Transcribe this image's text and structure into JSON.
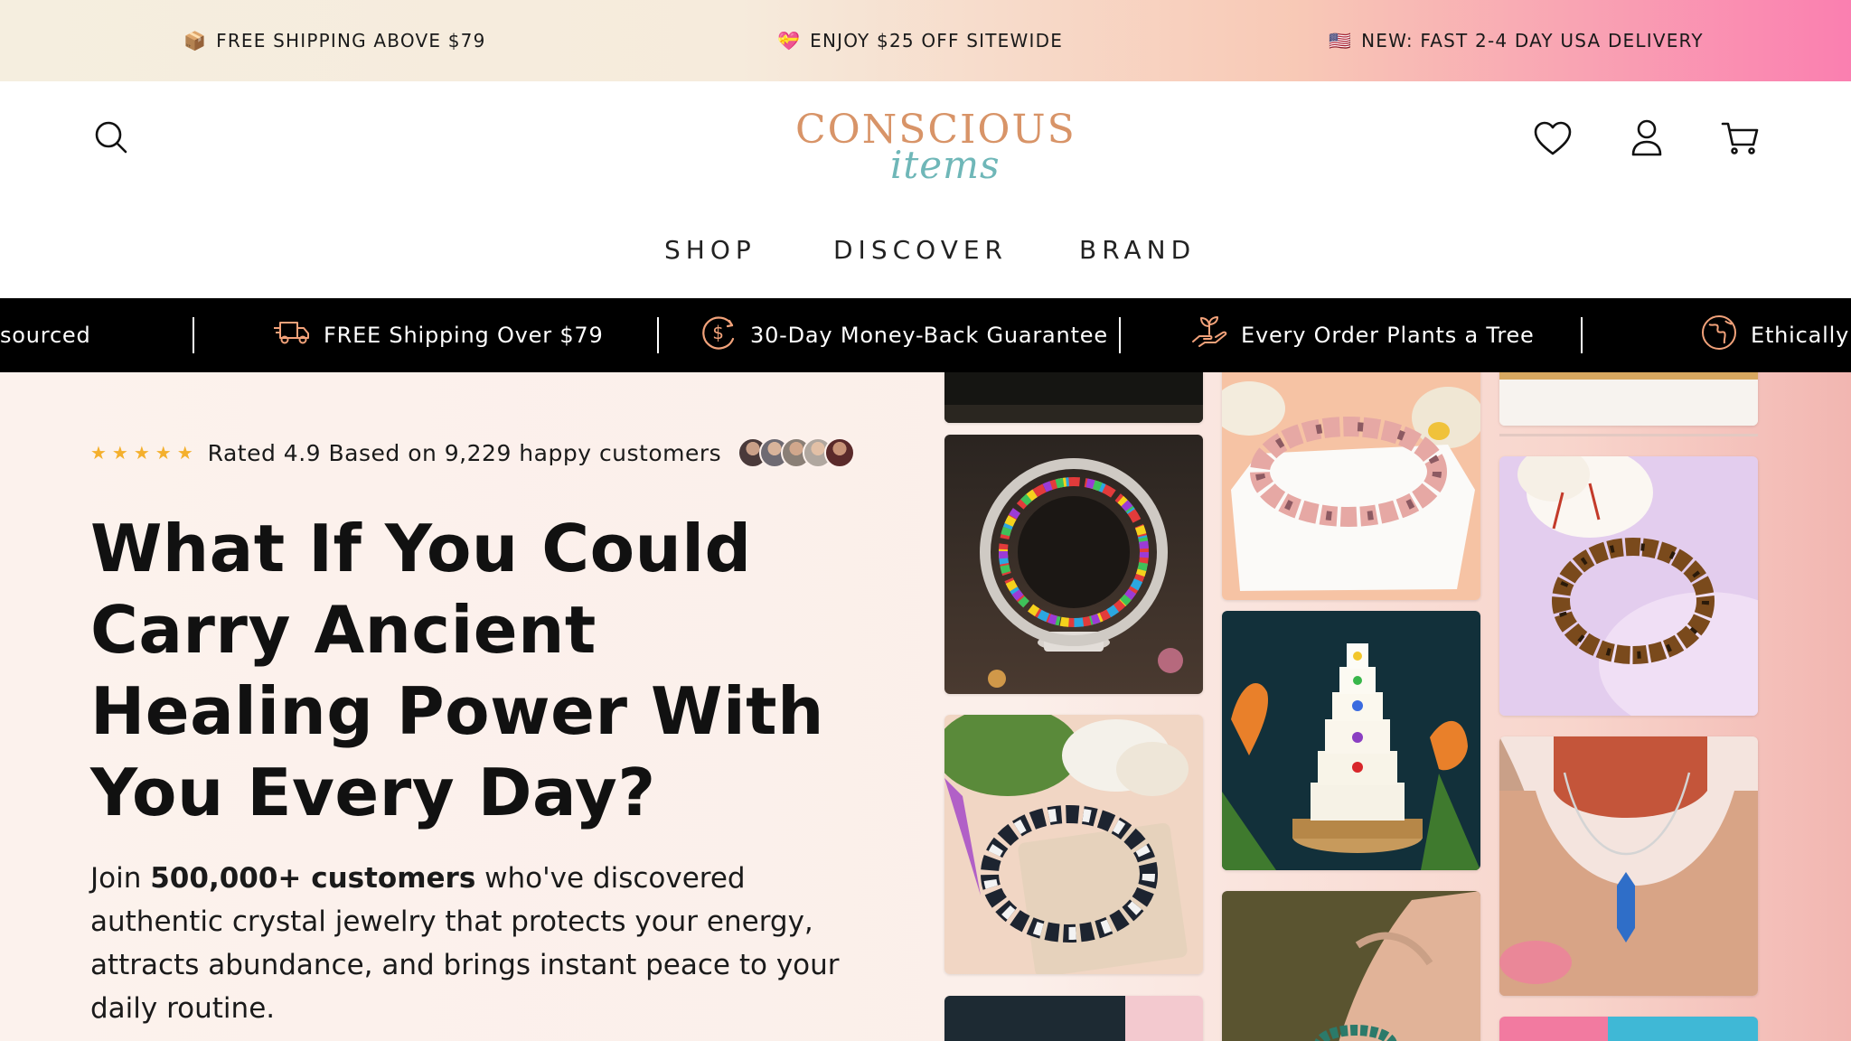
{
  "announcement": {
    "items": [
      {
        "emoji": "📦",
        "text": "FREE SHIPPING ABOVE $79"
      },
      {
        "emoji": "💝",
        "text": "ENJOY $25 OFF SITEWIDE"
      },
      {
        "emoji": "🇺🇸",
        "text": "NEW: FAST 2-4 DAY USA DELIVERY"
      }
    ]
  },
  "header": {
    "logo_main": "CONSCIOUS",
    "logo_sub": "items",
    "icons": [
      "search-icon",
      "heart-icon",
      "user-icon",
      "cart-icon"
    ],
    "nav": [
      "SHOP",
      "DISCOVER",
      "BRAND"
    ]
  },
  "trust": {
    "items": [
      {
        "icon": "globe-icon",
        "text": "sourced"
      },
      {
        "icon": "truck-icon",
        "text": "FREE Shipping Over $79"
      },
      {
        "icon": "dollar-circle-icon",
        "text": "30-Day Money-Back Guarantee"
      },
      {
        "icon": "plant-hand-icon",
        "text": "Every Order Plants a Tree"
      },
      {
        "icon": "globe-icon",
        "text": "Ethically s"
      }
    ]
  },
  "hero": {
    "stars": "★★★★★",
    "rating_text": "Rated 4.9 Based on 9,229 happy customers",
    "headline": "What If You Could Carry Ancient Healing Power With You Every Day?",
    "sub_pre": "Join ",
    "sub_bold": "500,000+ customers",
    "sub_post": " who've discovered authentic crystal jewelry that protects your energy, attracts abundance, and brings instant peace to your daily routine."
  },
  "colors": {
    "accent_logo": "#d89468",
    "accent_logo_sub": "#6fb7b8",
    "stars": "#f4b02d",
    "trust_bg": "#000000"
  }
}
